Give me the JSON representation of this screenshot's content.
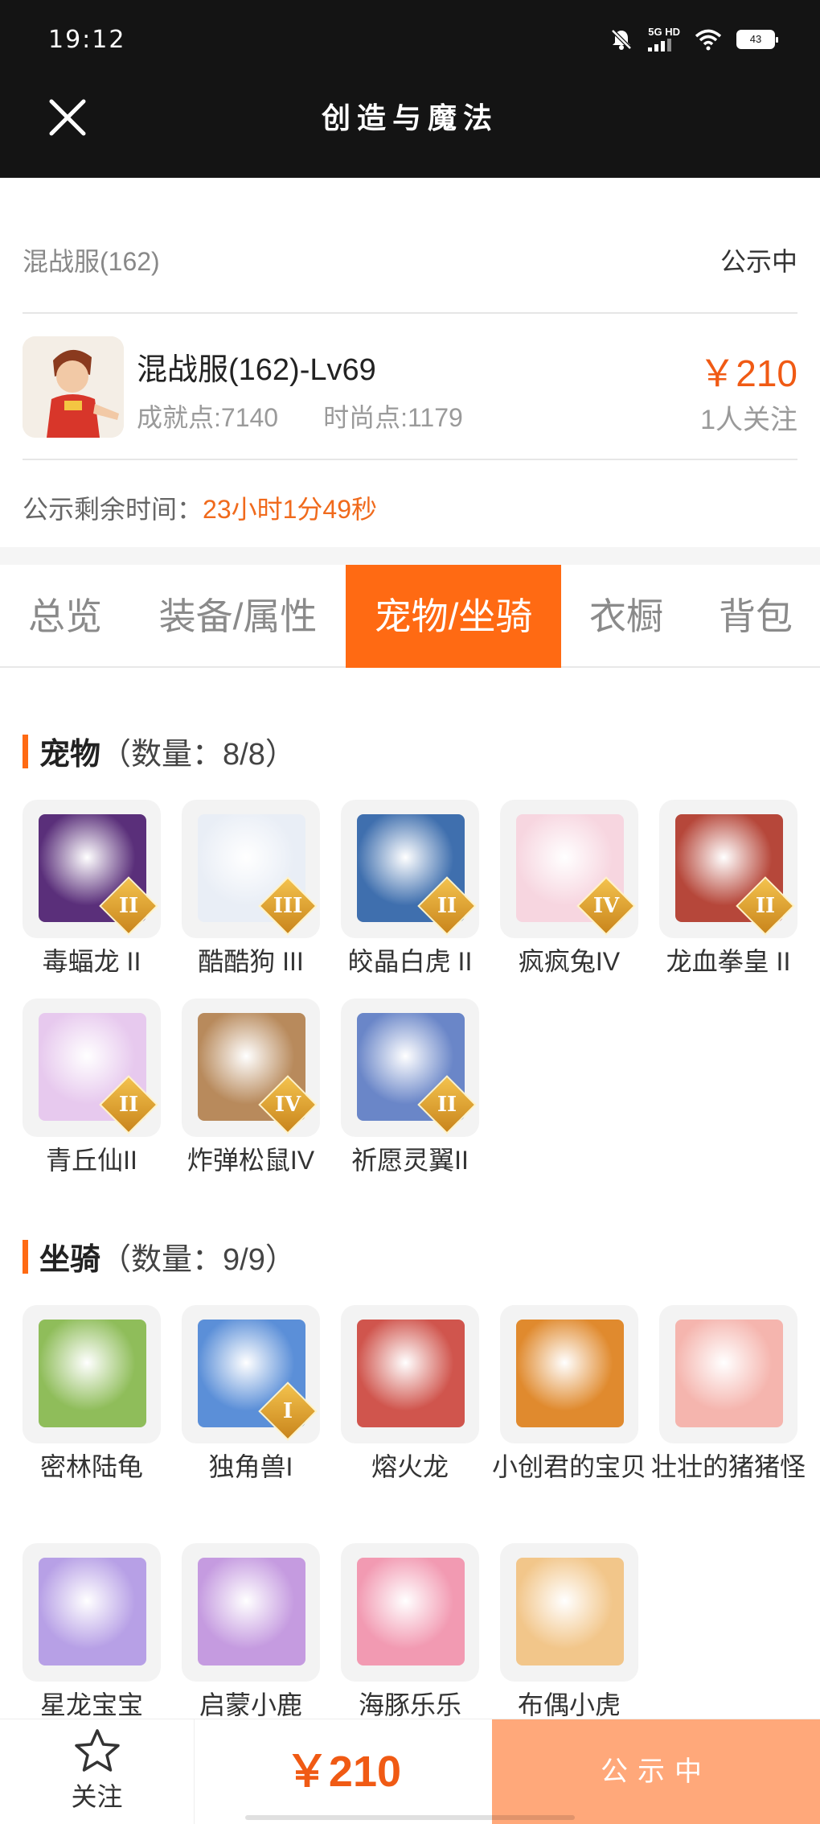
{
  "status_bar": {
    "time": "19:12",
    "network": "5G HD",
    "battery": "43"
  },
  "title_bar": {
    "title": "创造与魔法",
    "close_icon": "close-icon"
  },
  "header": {
    "server_name": "混战服(162)",
    "listing_status": "公示中",
    "character_name": "混战服(162)-Lv69",
    "achievement_points": "成就点:7140",
    "fashion_points": "时尚点:1179",
    "price": "￥210",
    "followers": "1人关注",
    "countdown_label": "公示剩余时间：",
    "countdown_value": "23小时1分49秒"
  },
  "tabs": [
    {
      "label": "总览"
    },
    {
      "label": "装备/属性"
    },
    {
      "label": "宠物/坐骑",
      "active": true
    },
    {
      "label": "衣橱"
    },
    {
      "label": "背包"
    }
  ],
  "pets": {
    "title": "宠物",
    "count": "（数量：8/8）",
    "items": [
      {
        "name": "毒蝠龙 II",
        "rank": "II",
        "color": "#5a2f7a"
      },
      {
        "name": "酷酷狗 III",
        "rank": "III",
        "color": "#e9eef6"
      },
      {
        "name": "皎晶白虎 II",
        "rank": "II",
        "color": "#3f6fae"
      },
      {
        "name": "疯疯兔IV",
        "rank": "IV",
        "color": "#f7d6e0"
      },
      {
        "name": "龙血拳皇 II",
        "rank": "II",
        "color": "#b6473a"
      },
      {
        "name": "青丘仙II",
        "rank": "II",
        "color": "#e7c9ee"
      },
      {
        "name": "炸弹松鼠IV",
        "rank": "IV",
        "color": "#b88a5c"
      },
      {
        "name": "祈愿灵翼II",
        "rank": "II",
        "color": "#6a86c8"
      }
    ]
  },
  "mounts": {
    "title": "坐骑",
    "count": "（数量：9/9）",
    "items": [
      {
        "name": "密林陆龟",
        "rank": "",
        "color": "#8fbd5a"
      },
      {
        "name": "独角兽I",
        "rank": "I",
        "color": "#5b8fd8"
      },
      {
        "name": "熔火龙",
        "rank": "",
        "color": "#d0554d"
      },
      {
        "name": "小创君的宝贝",
        "rank": "",
        "color": "#e08a2e"
      },
      {
        "name": "壮壮的猪猪怪",
        "rank": "",
        "color": "#f5b5ae"
      },
      {
        "name": "星龙宝宝",
        "rank": "",
        "color": "#b7a0e6"
      },
      {
        "name": "启蒙小鹿",
        "rank": "",
        "color": "#c59be0"
      },
      {
        "name": "海豚乐乐",
        "rank": "",
        "color": "#f29ab2"
      },
      {
        "name": "布偶小虎",
        "rank": "",
        "color": "#f2c68a"
      }
    ]
  },
  "bottom_bar": {
    "follow_label": "关注",
    "price": "￥210",
    "action_label": "公示中"
  },
  "colors": {
    "accent": "#ff6a13",
    "price": "#f05a14",
    "cta": "#ffa87a"
  }
}
